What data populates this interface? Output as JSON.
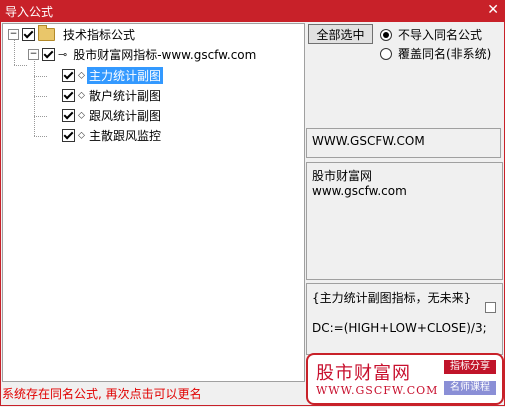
{
  "window": {
    "title": "导入公式",
    "close_glyph": "✕"
  },
  "tree": {
    "root": {
      "label": "技术指标公式",
      "expander": "−",
      "checked": true
    },
    "group": {
      "label": "股市财富网指标-www.gscfw.com",
      "expander": "−",
      "checked": true
    },
    "items": [
      {
        "label": "主力统计副图",
        "checked": true,
        "selected": true
      },
      {
        "label": "散户统计副图",
        "checked": true,
        "selected": false
      },
      {
        "label": "跟风统计副图",
        "checked": true,
        "selected": false
      },
      {
        "label": "主散跟风监控",
        "checked": true,
        "selected": false
      }
    ]
  },
  "controls": {
    "select_all": "全部选中",
    "radio_skip": "不导入同名公式",
    "radio_overwrite": "覆盖同名(非系统)"
  },
  "info": {
    "url": "WWW.GSCFW.COM",
    "desc_line1": "股市财富网",
    "desc_line2": "www.gscfw.com"
  },
  "formula": {
    "title": "{主力统计副图指标，无未来}",
    "code": "DC:=(HIGH+LOW+CLOSE)/3;"
  },
  "status": "系统存在同名公式, 再次点击可以更名",
  "watermark": {
    "name": "股市财富网",
    "url": "WWW.GSCFW.COM",
    "tag1": "指标分享",
    "tag2": "名师课程"
  },
  "colors": {
    "titlebar": "#c82129",
    "selection": "#3399ff",
    "status_text": "#e00000",
    "tag1": "#c0142a",
    "tag2": "#8a8fd6"
  }
}
